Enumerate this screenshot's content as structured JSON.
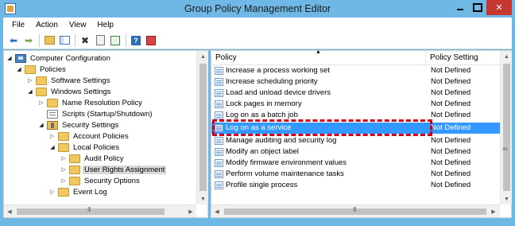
{
  "window": {
    "title": "Group Policy Management Editor",
    "controls": {
      "minimize": "",
      "maximize": "",
      "close": "✕"
    }
  },
  "menu": {
    "items": [
      "File",
      "Action",
      "View",
      "Help"
    ]
  },
  "toolbar": {
    "buttons": [
      "back-icon",
      "forward-icon",
      "up-folder-icon",
      "show-hide-tree-icon",
      "delete-icon",
      "properties-icon",
      "export-icon",
      "help-icon",
      "filter-icon"
    ],
    "glyphs": {
      "back": "⬅",
      "forward": "➡",
      "delete": "✖",
      "help": "?"
    }
  },
  "tree": {
    "items": [
      {
        "label": "Computer Configuration",
        "expander": "◢",
        "icon": "computer-icon"
      },
      {
        "label": "Policies",
        "expander": "◢",
        "icon": "folder-icon"
      },
      {
        "label": "Software Settings",
        "expander": "▷",
        "icon": "folder-icon"
      },
      {
        "label": "Windows Settings",
        "expander": "◢",
        "icon": "folder-icon"
      },
      {
        "label": "Name Resolution Policy",
        "expander": "▷",
        "icon": "folder-icon"
      },
      {
        "label": "Scripts (Startup/Shutdown)",
        "expander": "",
        "icon": "script-icon"
      },
      {
        "label": "Security Settings",
        "expander": "◢",
        "icon": "security-icon"
      },
      {
        "label": "Account Policies",
        "expander": "▷",
        "icon": "folder-icon"
      },
      {
        "label": "Local Policies",
        "expander": "◢",
        "icon": "folder-icon"
      },
      {
        "label": "Audit Policy",
        "expander": "▷",
        "icon": "folder-icon"
      },
      {
        "label": "User Rights Assignment",
        "expander": "▷",
        "icon": "folder-icon",
        "selected": true
      },
      {
        "label": "Security Options",
        "expander": "▷",
        "icon": "folder-icon"
      },
      {
        "label": "Event Log",
        "expander": "▷",
        "icon": "folder-icon"
      }
    ],
    "scroll": {
      "up": "▲",
      "down": "▼",
      "left": "◀",
      "right": "▶",
      "grip": "III"
    }
  },
  "list": {
    "headers": {
      "policy": "Policy",
      "setting": "Policy Setting",
      "sort": "▲"
    },
    "rows": [
      {
        "policy": "Increase a process working set",
        "setting": "Not Defined"
      },
      {
        "policy": "Increase scheduling priority",
        "setting": "Not Defined"
      },
      {
        "policy": "Load and unload device drivers",
        "setting": "Not Defined"
      },
      {
        "policy": "Lock pages in memory",
        "setting": "Not Defined"
      },
      {
        "policy": "Log on as a batch job",
        "setting": "Not Defined"
      },
      {
        "policy": "Log on as a service",
        "setting": "Not Defined",
        "selected": true
      },
      {
        "policy": "Manage auditing and security log",
        "setting": "Not Defined"
      },
      {
        "policy": "Modify an object label",
        "setting": "Not Defined"
      },
      {
        "policy": "Modify firmware environment values",
        "setting": "Not Defined"
      },
      {
        "policy": "Perform volume maintenance tasks",
        "setting": "Not Defined"
      },
      {
        "policy": "Profile single process",
        "setting": "Not Defined"
      }
    ],
    "scroll": {
      "up": "▲",
      "down": "▼",
      "left": "◀",
      "right": "▶",
      "grip": "III"
    }
  },
  "colors": {
    "chrome": "#6fb8e6",
    "selection": "#3399ff",
    "highlight_box": "#d0021b",
    "close_button": "#c7372f"
  }
}
